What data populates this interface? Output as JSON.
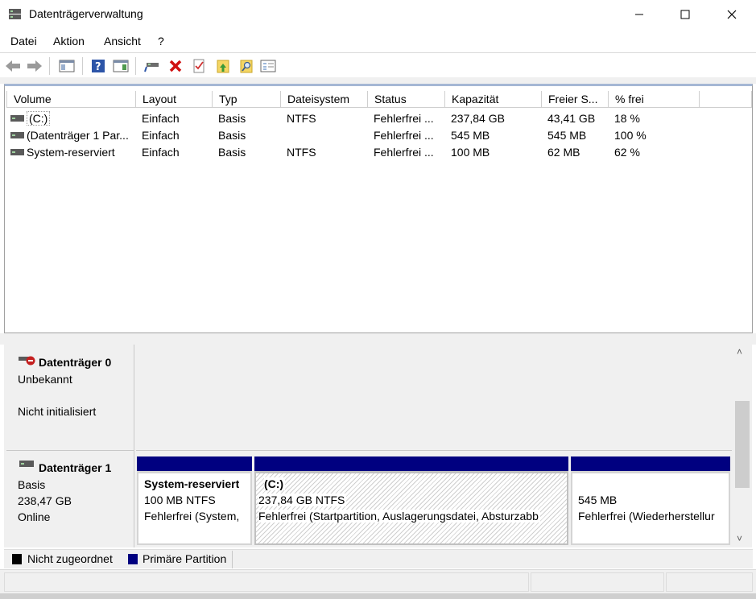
{
  "window": {
    "title": "Datenträgerverwaltung",
    "controls": [
      "minimize",
      "maximize",
      "close"
    ]
  },
  "menu": {
    "items": [
      "Datei",
      "Aktion",
      "Ansicht",
      "?"
    ]
  },
  "toolbar": {
    "icons": [
      "back-icon",
      "forward-icon",
      "show-pane-icon",
      "help-icon",
      "console-tree-icon",
      "connect-icon",
      "delete-icon",
      "check-icon",
      "folder-up-icon",
      "search-folder-icon",
      "properties-icon"
    ]
  },
  "volume_list": {
    "columns": [
      "Volume",
      "Layout",
      "Typ",
      "Dateisystem",
      "Status",
      "Kapazität",
      "Freier S...",
      "% frei"
    ],
    "rows": [
      {
        "volume": "(C:)",
        "layout": "Einfach",
        "typ": "Basis",
        "fs": "NTFS",
        "status": "Fehlerfrei ...",
        "kap": "237,84 GB",
        "frei": "43,41 GB",
        "pct": "18 %"
      },
      {
        "volume": "(Datenträger 1 Par...",
        "layout": "Einfach",
        "typ": "Basis",
        "fs": "",
        "status": "Fehlerfrei ...",
        "kap": "545 MB",
        "frei": "545 MB",
        "pct": "100 %"
      },
      {
        "volume": "System-reserviert",
        "layout": "Einfach",
        "typ": "Basis",
        "fs": "NTFS",
        "status": "Fehlerfrei ...",
        "kap": "100 MB",
        "frei": "62 MB",
        "pct": "62 %"
      }
    ]
  },
  "disks": {
    "disk0": {
      "name": "Datenträger 0",
      "type": "Unbekannt",
      "state": "Nicht initialisiert"
    },
    "disk1": {
      "name": "Datenträger 1",
      "type": "Basis",
      "size": "238,47 GB",
      "state": "Online",
      "partitions": [
        {
          "title": "System-reserviert",
          "size": "100 MB NTFS",
          "status": "Fehlerfrei (System,"
        },
        {
          "title": "(C:)",
          "size": "237,84 GB NTFS",
          "status": "Fehlerfrei (Startpartition, Auslagerungsdatei, Absturzabb"
        },
        {
          "title": "",
          "size": "545 MB",
          "status": "Fehlerfrei (Wiederherstellur"
        }
      ]
    }
  },
  "legend": {
    "unallocated": "Nicht zugeordnet",
    "primary": "Primäre Partition",
    "unallocated_color": "#000000",
    "primary_color": "#000080"
  }
}
